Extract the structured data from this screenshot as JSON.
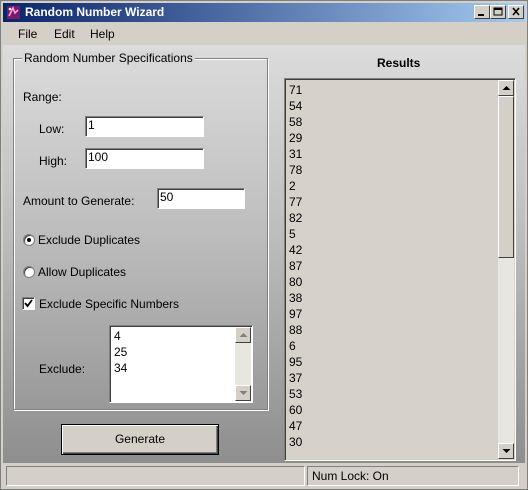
{
  "window": {
    "title": "Random Number Wizard",
    "icon": "app-icon"
  },
  "menu": {
    "items": [
      "File",
      "Edit",
      "Help"
    ]
  },
  "specs": {
    "group_title": "Random Number Specifications",
    "range_label": "Range:",
    "low_label": "Low:",
    "low_value": "1",
    "high_label": "High:",
    "high_value": "100",
    "amount_label": "Amount to Generate:",
    "amount_value": "50",
    "exclude_duplicates_label": "Exclude Duplicates",
    "exclude_duplicates_selected": true,
    "allow_duplicates_label": "Allow Duplicates",
    "allow_duplicates_selected": false,
    "exclude_specific_label": "Exclude Specific Numbers",
    "exclude_specific_checked": true,
    "exclude_label": "Exclude:",
    "exclude_values": [
      "4",
      "25",
      "34"
    ]
  },
  "generate_button": "Generate",
  "results": {
    "title": "Results",
    "values": [
      "71",
      "54",
      "58",
      "29",
      "31",
      "78",
      "2",
      "77",
      "82",
      "5",
      "42",
      "87",
      "80",
      "38",
      "97",
      "88",
      "6",
      "95",
      "37",
      "53",
      "60",
      "47",
      "30"
    ]
  },
  "statusbar": {
    "main_text": "",
    "num_lock": "Num Lock:  On"
  },
  "colors": {
    "titlebar_start": "#0a246a",
    "titlebar_end": "#a6caf0",
    "face": "#d4d0c8"
  }
}
